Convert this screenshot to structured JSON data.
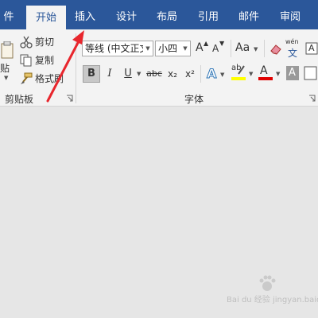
{
  "tabs": [
    {
      "label": "件"
    },
    {
      "label": "开始",
      "active": true
    },
    {
      "label": "插入"
    },
    {
      "label": "设计"
    },
    {
      "label": "布局"
    },
    {
      "label": "引用"
    },
    {
      "label": "邮件"
    },
    {
      "label": "审阅"
    }
  ],
  "clipboard": {
    "paste_label": "贴",
    "cut_label": "剪切",
    "copy_label": "复制",
    "format_painter_label": "格式刷",
    "group_label": "剪贴板"
  },
  "font": {
    "font_name": "等线 (中文正文",
    "font_size": "小四",
    "case_label": "Aa",
    "phonetic_top": "wén",
    "phonetic_bottom": "文",
    "bold": "B",
    "italic": "I",
    "underline": "U",
    "strike": "abc",
    "subscript": "x₂",
    "superscript": "x²",
    "text_effects": "A",
    "highlight": "ab",
    "font_color": "A",
    "char_shading": "A",
    "enclose": "A",
    "group_label": "字体"
  },
  "colors": {
    "tab_bar": "#2b579a",
    "ribbon": "#f3f3f3",
    "canvas": "#e6e6e6",
    "highlight_yellow": "#ffff00",
    "font_red": "#e00000",
    "arrow_red": "#e8262d"
  },
  "watermark": "Bai du 经验 jingyan.baidu.com"
}
